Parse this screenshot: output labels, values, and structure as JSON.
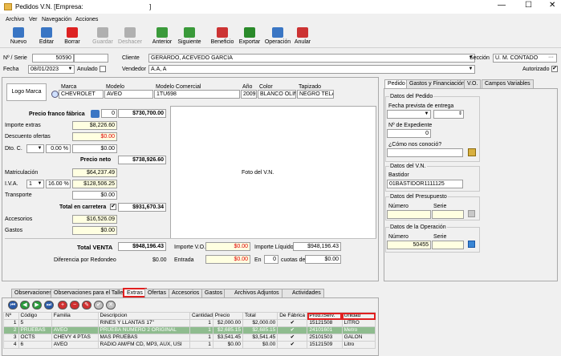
{
  "window": {
    "title": "Pedidos V.N. [Empresa:",
    "title_tail": "]"
  },
  "menu": [
    "Archivo",
    "Ver",
    "Navegación",
    "Acciones"
  ],
  "toolbar": [
    {
      "label": "Nuevo",
      "color": "#3a76c4",
      "enabled": true
    },
    {
      "label": "Editar",
      "color": "#3a76c4",
      "enabled": true
    },
    {
      "label": "Borrar",
      "color": "#d22",
      "enabled": true
    },
    {
      "label": "Guardar",
      "color": "#b0b0b0",
      "enabled": false
    },
    {
      "label": "Deshacer",
      "color": "#b0b0b0",
      "enabled": false
    },
    {
      "label": "Anterior",
      "color": "#3a9a3a",
      "enabled": true
    },
    {
      "label": "Siguiente",
      "color": "#3a9a3a",
      "enabled": true
    },
    {
      "label": "Beneficio",
      "color": "#c33",
      "enabled": true
    },
    {
      "label": "Exportar",
      "color": "#2a8a2a",
      "enabled": true
    },
    {
      "label": "Operación",
      "color": "#3a76c4",
      "enabled": true
    },
    {
      "label": "Anular",
      "color": "#c33",
      "enabled": true
    }
  ],
  "header": {
    "serie_label": "Nº / Serie",
    "serie_num": "50590",
    "cliente_label": "Cliente",
    "cliente": "GERARDO, ACEVEDO GARCIA",
    "seccion_label": "Sección",
    "seccion": "U. M. CONTADO",
    "fecha_label": "Fecha",
    "fecha": "08/01/2023",
    "anulado_label": "Anulado",
    "vendedor_label": "Vendedor",
    "vendedor": "A.A, A",
    "autorizado_label": "Autorizado"
  },
  "vehicle": {
    "logo": "Logo Marca",
    "marca_label": "Marca",
    "marca": "CHEVROLET",
    "modelo_label": "Modelo",
    "modelo": "AVEO",
    "modcom_label": "Modelo Comercial",
    "modcom": "1TU698",
    "anio_label": "Año",
    "anio": "2009",
    "color_label": "Color",
    "color": "BLANCO OLIMF",
    "tapizado_label": "Tapizado",
    "tapizado": "NEGRO TELA",
    "foto": "Foto del V.N."
  },
  "prices": {
    "franco_label": "Precio franco fábrica",
    "franco_qty": "0",
    "franco": "$730,700.00",
    "extras_label": "Importe extras",
    "extras": "$8,226.60",
    "desc_label": "Descuento ofertas",
    "desc": "$0.00",
    "dto_label": "Dto. C.",
    "dto_pct": "0.00 %",
    "dto": "$0.00",
    "neto_label": "Precio neto",
    "neto": "$738,926.60",
    "matric_label": "Matriculación",
    "matric": "$64,237.49",
    "iva_label": "I.V.A.",
    "iva_n": "1",
    "iva_pct": "16.00 %",
    "iva": "$128,506.25",
    "transp_label": "Transporte",
    "transp": "$0.00",
    "carretera_label": "Total en carretera",
    "carretera": "$931,670.34",
    "acces_label": "Accesorios",
    "acces": "$16,526.09",
    "gastos_label": "Gastos",
    "gastos": "$0.00",
    "venta_label": "Total VENTA",
    "venta": "$948,196.43",
    "redondeo_label": "Diferencia por Redondeo",
    "redondeo": "$0.00",
    "impvo_label": "Importe V.O.",
    "impvo": "$0.00",
    "entrada_label": "Entrada",
    "entrada": "$0.00",
    "liquido_label": "Importe Líquido",
    "liquido": "$948,196.43",
    "en_label": "En",
    "cuotas_n": "0",
    "cuotas_label": "cuotas de",
    "cuotas": "$0.00"
  },
  "right_tabs": [
    "Pedido",
    "Gastos y Financiación",
    "V.O.",
    "Campos Variables"
  ],
  "pedido": {
    "datos_title": "Datos del Pedido",
    "fecha_entrega_label": "Fecha prevista de entrega",
    "expediente_label": "Nº de Expediente",
    "expediente": "0",
    "conocio_label": "¿Cómo nos conoció?",
    "vn_title": "Datos del V.N.",
    "bastidor_label": "Bastidor",
    "bastidor": "01BASTIDOR1111125",
    "presu_title": "Datos del Presupuesto",
    "numero_label": "Número",
    "serie_label": "Serie",
    "oper_title": "Datos de la Operación",
    "oper_numero": "50455"
  },
  "bottom_tabs": [
    "Observaciones",
    "Observaciones para el Taller",
    "Extras",
    "Ofertas",
    "Accesorios",
    "Gastos",
    "Archivos Adjuntos",
    "Actividades"
  ],
  "grid": {
    "headers": [
      "Nº",
      "Código",
      "Familia",
      "Descripcion",
      "Cantidad",
      "Precio",
      "Total",
      "De Fábrica",
      "Prod./Serv.",
      "Unidad"
    ],
    "rows": [
      [
        "1",
        "5",
        "",
        "RINES Y LLANTAS 17\"",
        "1",
        "$2,000.00",
        "$2,000.00",
        "✔",
        "15121508",
        "LITRO"
      ],
      [
        "2",
        "PRUEBAS",
        "AVEO",
        "PRUEBA NUMERO 2 ORIGINAL",
        "1",
        "$2,685.15",
        "$2,685.15",
        "✔",
        "24101601",
        "Metro"
      ],
      [
        "3",
        "OCTS",
        "CHEVY 4 PTAS",
        "MAS PRUEBAS",
        "1",
        "$3,541.45",
        "$3,541.45",
        "✔",
        "25101503",
        "GALON"
      ],
      [
        "4",
        "6",
        "AVEO",
        "RADIO AM/FM CD, MP3, AUX, USI",
        "1",
        "$0.00",
        "$0.00",
        "✔",
        "15121509",
        "Litro"
      ]
    ]
  },
  "colors": {
    "highlight": "#e02020",
    "navy": "#1a3a8a"
  }
}
